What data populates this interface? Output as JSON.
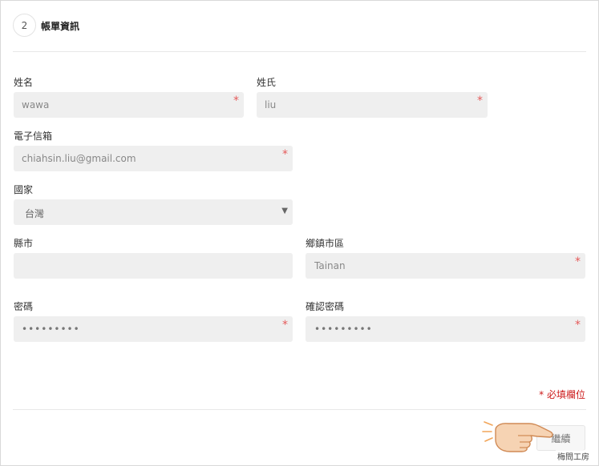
{
  "step": {
    "number": "2",
    "title": "帳單資訊"
  },
  "form": {
    "first_name": {
      "label": "姓名",
      "value": "wawa"
    },
    "last_name": {
      "label": "姓氏",
      "value": "liu"
    },
    "email": {
      "label": "電子信箱",
      "value": "chiahsin.liu@gmail.com"
    },
    "country": {
      "label": "國家",
      "value": "台灣"
    },
    "county": {
      "label": "縣市",
      "value": ""
    },
    "district": {
      "label": "鄉鎮市區",
      "value": "Tainan"
    },
    "password": {
      "label": "密碼",
      "value": "•••••••••"
    },
    "confirm_password": {
      "label": "確認密碼",
      "value": "•••••••••"
    },
    "required_mark": "*"
  },
  "required_note": "* 必填欄位",
  "continue_label": "繼續",
  "watermark": "梅問工房",
  "colors": {
    "required": "#e55a5a",
    "note": "#cc1a1a",
    "field_bg": "#efefef",
    "hand": "#f6d3b3"
  }
}
